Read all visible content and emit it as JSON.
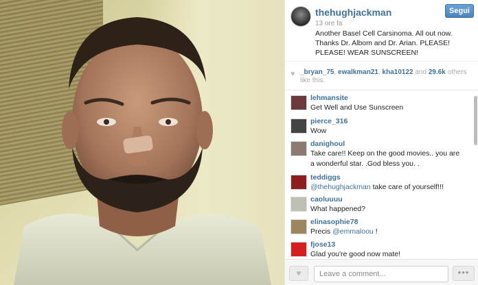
{
  "post": {
    "username": "thehughjackman",
    "follow_label": "Segui",
    "time_ago": "13 ore fa",
    "caption": "Another Basel Cell Carsinoma. All out now. Thanks Dr. Albom and Dr. Arian. PLEASE! PLEASE! WEAR SUNSCREEN!"
  },
  "likes": {
    "users": [
      "_bryan_75",
      "ewalkman21",
      "kha10122"
    ],
    "separator": ", ",
    "joiner": " and ",
    "count": "29.6k",
    "suffix": " others like this.",
    "heart_icon": "heart-icon"
  },
  "comments": [
    {
      "user": "lehmansite",
      "segments": [
        {
          "t": "Get Well and Use Sunscreen",
          "m": false
        }
      ],
      "avatar_color": "#6b3a3a"
    },
    {
      "user": "pierce_316",
      "segments": [
        {
          "t": "Wow",
          "m": false
        }
      ],
      "avatar_color": "#444444"
    },
    {
      "user": "danighoul",
      "segments": [
        {
          "t": "Take care!! Keep on the good movies.. you are a wonderful star. .God bless you. .",
          "m": false
        }
      ],
      "avatar_color": "#8a7a70"
    },
    {
      "user": "teddiggs",
      "segments": [
        {
          "t": "@thehughjackman",
          "m": true
        },
        {
          "t": " take care of yourself!!!",
          "m": false
        }
      ],
      "avatar_color": "#8e1f1f"
    },
    {
      "user": "caoluuuu",
      "segments": [
        {
          "t": "What happened?",
          "m": false
        }
      ],
      "avatar_color": "#bfbfb5"
    },
    {
      "user": "elinasophie78",
      "segments": [
        {
          "t": "Precis ",
          "m": false
        },
        {
          "t": "@emmaloou",
          "m": true
        },
        {
          "t": " !",
          "m": false
        }
      ],
      "avatar_color": "#9c8660"
    },
    {
      "user": "fjose13",
      "segments": [
        {
          "t": "Glad you're good now mate!",
          "m": false
        }
      ],
      "avatar_color": "#d42020"
    }
  ],
  "footer": {
    "comment_placeholder": "Leave a comment...",
    "more_label": "•••"
  },
  "colors": {
    "accent": "#3f729b",
    "follow_button": "#4a84c0"
  }
}
